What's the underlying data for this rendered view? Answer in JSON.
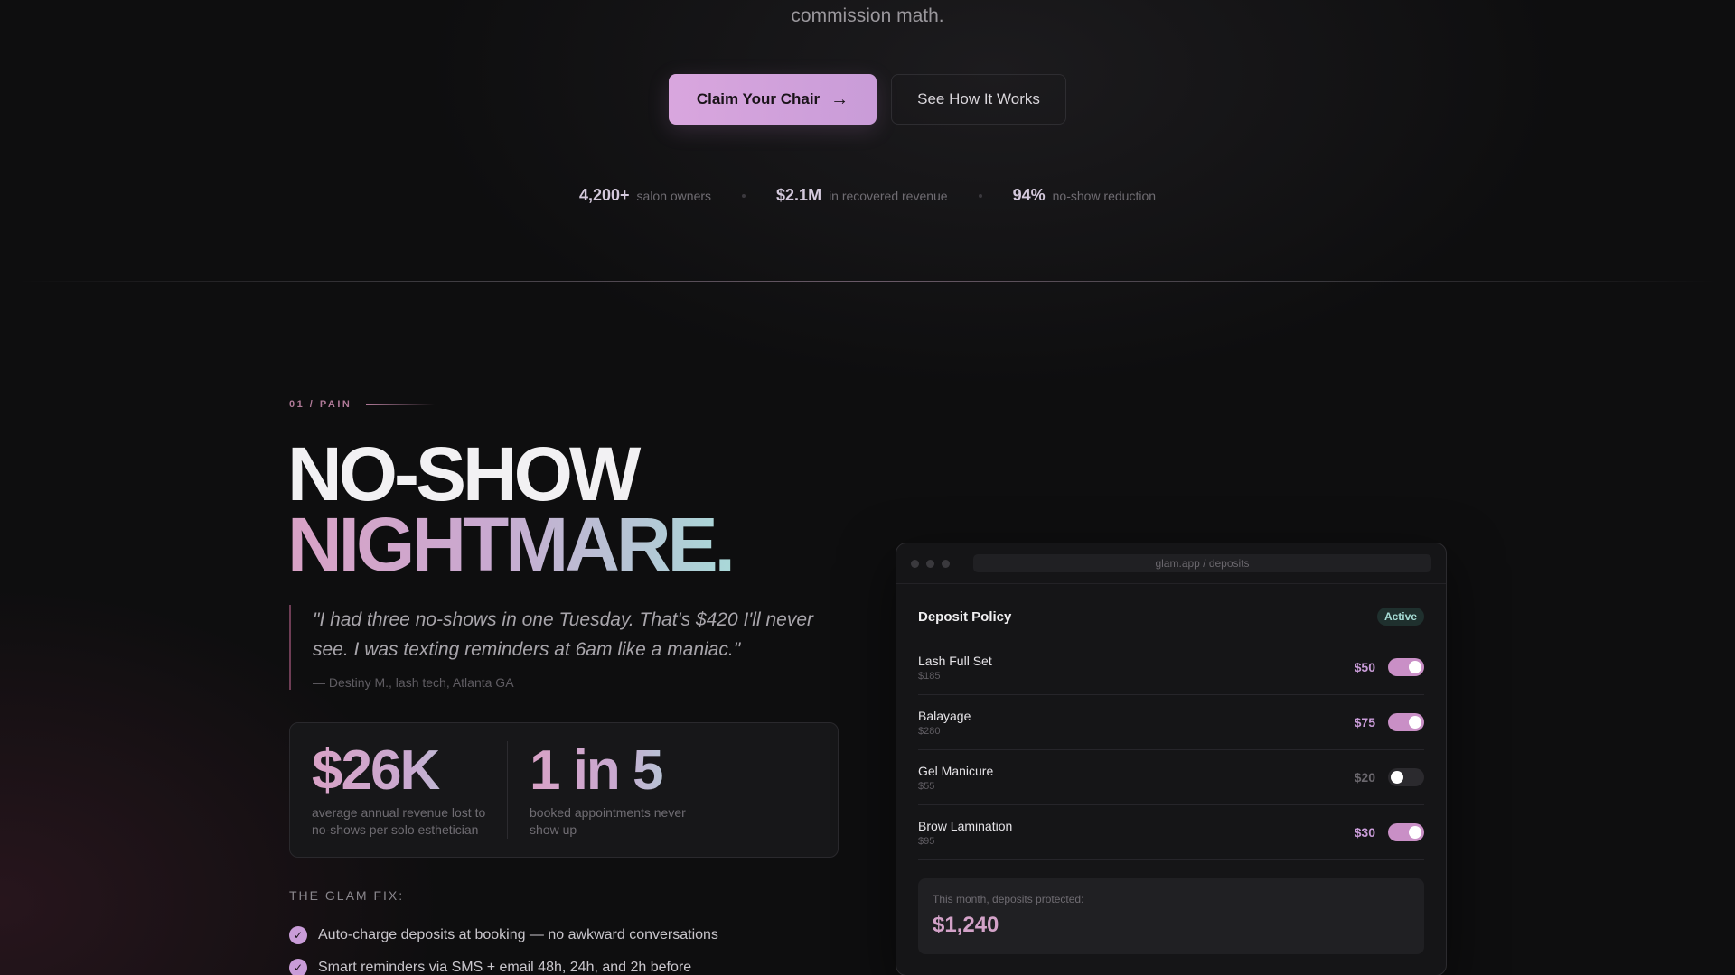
{
  "hero": {
    "subtitle_tail": "commission math.",
    "cta_primary": "Claim Your Chair",
    "cta_secondary": "See How It Works",
    "stats": [
      {
        "value": "4,200+",
        "label": "salon owners"
      },
      {
        "value": "$2.1M",
        "label": "in recovered revenue"
      },
      {
        "value": "94%",
        "label": "no-show reduction"
      }
    ]
  },
  "pain": {
    "eyebrow": "01 / PAIN",
    "headline_1": "NO-SHOW",
    "headline_2": "NIGHTMARE.",
    "quote": "\"I had three no-shows in one Tuesday. That's $420 I'll never see. I was texting reminders at 6am like a maniac.\"",
    "attribution": "— Destiny M., lash tech, Atlanta GA",
    "stat_1_value": "$26K",
    "stat_1_label": "average annual revenue lost to no-shows per solo esthetician",
    "stat_2_value": "1 in 5",
    "stat_2_label": "booked appointments never show up",
    "fix_title": "THE GLAM FIX:",
    "fix_items": [
      "Auto-charge deposits at booking — no awkward conversations",
      "Smart reminders via SMS + email 48h, 24h, and 2h before"
    ]
  },
  "app": {
    "url": "glam.app / deposits",
    "title": "Deposit Policy",
    "status": "Active",
    "services": [
      {
        "name": "Lash Full Set",
        "price": "$185",
        "deposit": "$50",
        "enabled": true
      },
      {
        "name": "Balayage",
        "price": "$280",
        "deposit": "$75",
        "enabled": true
      },
      {
        "name": "Gel Manicure",
        "price": "$55",
        "deposit": "$20",
        "enabled": false
      },
      {
        "name": "Brow Lamination",
        "price": "$95",
        "deposit": "$30",
        "enabled": true
      }
    ],
    "summary_label": "This month, deposits protected:",
    "summary_value": "$1,240"
  },
  "colors": {
    "accent": "#c99cd8",
    "accent_pink": "#d9a2c6",
    "accent_teal": "#a9d8d8",
    "background": "#0e0e0f"
  }
}
